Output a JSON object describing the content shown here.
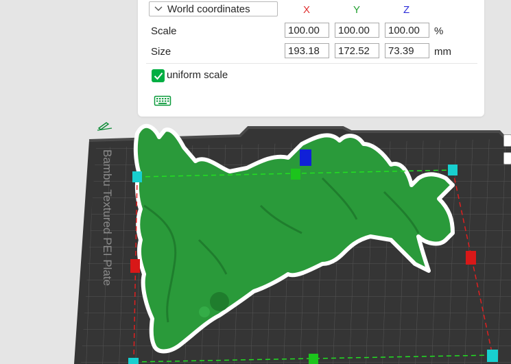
{
  "scale_panel": {
    "coordinate_system": "World coordinates",
    "axes": {
      "x": {
        "label": "X",
        "color": "#e03030"
      },
      "y": {
        "label": "Y",
        "color": "#22a030"
      },
      "z": {
        "label": "Z",
        "color": "#2b2bd8"
      }
    },
    "scale": {
      "label": "Scale",
      "x": "100.00",
      "y": "100.00",
      "z": "100.00",
      "unit": "%"
    },
    "size": {
      "label": "Size",
      "x": "193.18",
      "y": "172.52",
      "z": "73.39",
      "unit": "mm"
    },
    "uniform_scale": {
      "label": "uniform scale",
      "checked": true
    },
    "keyboard_icon": "keyboard-icon"
  },
  "build_plate": {
    "label": "Bambu Textured PEI Plate",
    "colors": {
      "plate": "#3b3b3b",
      "grid": "#5a5a5a",
      "model": "#2c9b3c",
      "outline": "#ffffff"
    }
  },
  "gizmo": {
    "colors": {
      "x_handle": "#d81818",
      "y_handle": "#1cc41c",
      "z_handle": "#1020d8",
      "corner": "#18d0d0",
      "box_x": "#e02020",
      "box_y": "#20d020"
    }
  },
  "icons": [
    "chevron-down-icon",
    "checkmark-icon",
    "keyboard-icon",
    "edit-icon"
  ]
}
